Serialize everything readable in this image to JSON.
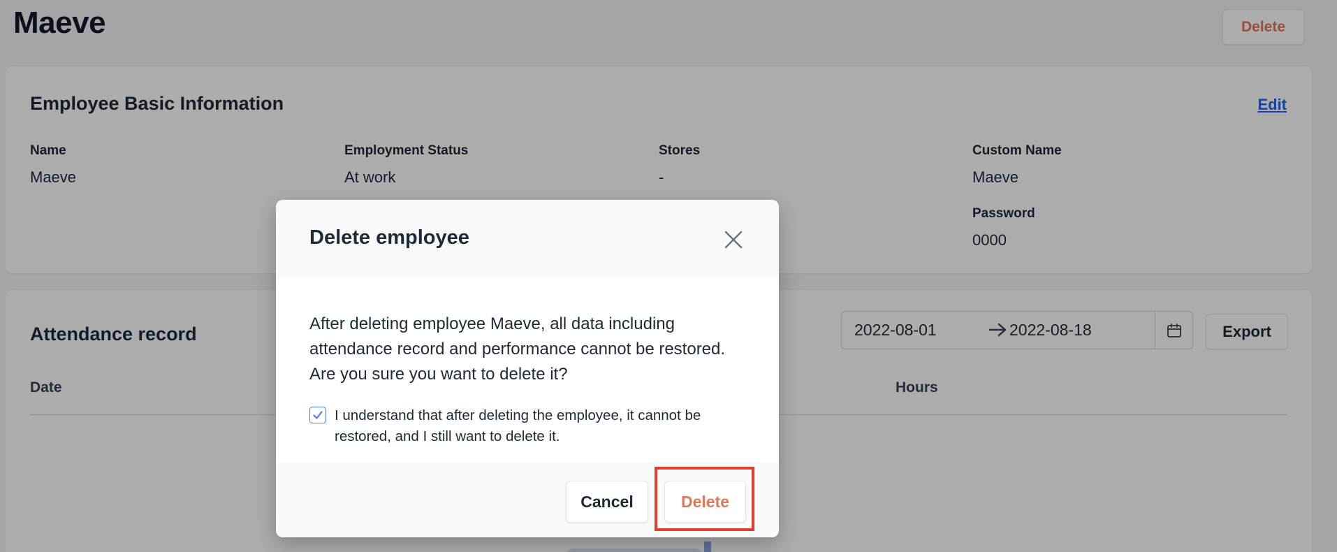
{
  "page": {
    "title": "Maeve",
    "delete_label": "Delete"
  },
  "basic_info": {
    "title": "Employee Basic Information",
    "edit_label": "Edit",
    "fields": {
      "name": {
        "label": "Name",
        "value": "Maeve"
      },
      "employment_status": {
        "label": "Employment Status",
        "value": "At work"
      },
      "stores": {
        "label": "Stores",
        "value": "-"
      },
      "custom_name": {
        "label": "Custom Name",
        "value": "Maeve"
      },
      "password": {
        "label": "Password",
        "value": "0000"
      }
    }
  },
  "attendance": {
    "title": "Attendance record",
    "date_start": "2022-08-01",
    "date_end": "2022-08-18",
    "export_label": "Export",
    "columns": {
      "date": "Date",
      "hours": "Hours"
    }
  },
  "modal": {
    "title": "Delete employee",
    "message": "After deleting employee Maeve, all data including attendance record and performance cannot be restored. Are you sure you want to delete it?",
    "confirm_text": "I understand that after deleting the employee, it cannot be restored, and I still want to delete it.",
    "confirm_checked": true,
    "cancel_label": "Cancel",
    "delete_label": "Delete"
  },
  "colors": {
    "danger": "#e0765a",
    "link": "#2563eb",
    "checkbox": "#4f7be6",
    "highlight": "#e2402d"
  }
}
